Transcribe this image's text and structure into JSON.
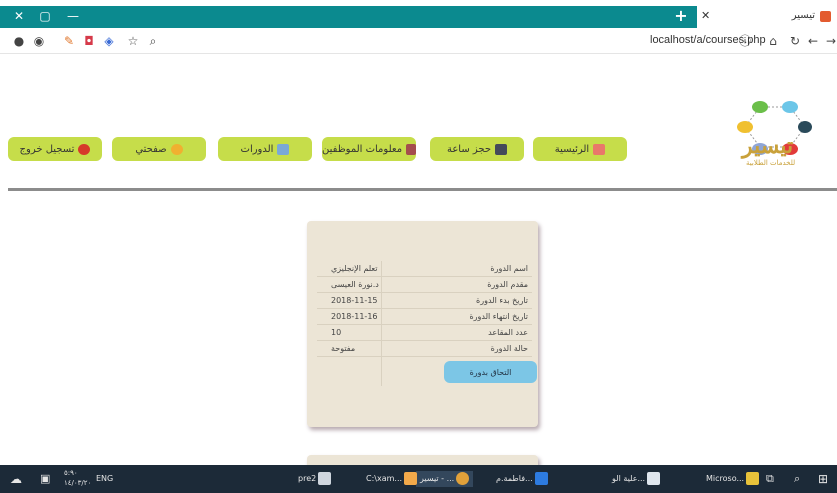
{
  "browser": {
    "window_controls": {
      "close": "✕",
      "restore": "▢",
      "minimize": "—"
    },
    "new_tab": "+",
    "tab": {
      "close": "✕",
      "title": "تيسير"
    },
    "url": "localhost/a/courses.php",
    "nav_icons": [
      "info-icon",
      "home-icon",
      "reload-icon",
      "back-icon",
      "forward-icon"
    ]
  },
  "site": {
    "logo_text": "تيسير",
    "logo_subtitle": "للخدمات الطلابية",
    "nav": [
      {
        "label": "الرئيسية",
        "icon": "home-icon",
        "color": "#e9786a"
      },
      {
        "label": "حجز ساعة",
        "icon": "calendar-icon",
        "color": "#444a5a"
      },
      {
        "label": "معلومات الموظفين",
        "icon": "staff-icon",
        "color": "#a44d4d"
      },
      {
        "label": "الدورات",
        "icon": "courses-icon",
        "color": "#7aa8d8"
      },
      {
        "label": "صفحتي",
        "icon": "pencil-icon",
        "color": "#f0b030"
      },
      {
        "label": "تسجيل خروج",
        "icon": "power-icon",
        "color": "#d63a2a"
      }
    ]
  },
  "course_card": {
    "rows": [
      {
        "label": "اسم الدورة",
        "value": "تعلم الإنجليزي"
      },
      {
        "label": "مقدم الدورة",
        "value": "د.نورة العيسى"
      },
      {
        "label": "تاريخ بدء الدورة",
        "value": "2018-11-15"
      },
      {
        "label": "تاريخ انتهاء الدورة",
        "value": "2018-11-16"
      },
      {
        "label": "عدد المقاعد",
        "value": "10"
      },
      {
        "label": "حالة الدورة",
        "value": "مفتوحة"
      }
    ],
    "join_label": "التحاق بدورة"
  },
  "taskbar": {
    "items": [
      "Microso...",
      "علية الو...",
      "فاطمة.م...",
      "تيسير - ...",
      "C:\\xam...",
      "pre2"
    ],
    "lang": "ENG",
    "clock_time": "٥:٩٠",
    "clock_date": "١٤/٠٣/٢٠"
  }
}
